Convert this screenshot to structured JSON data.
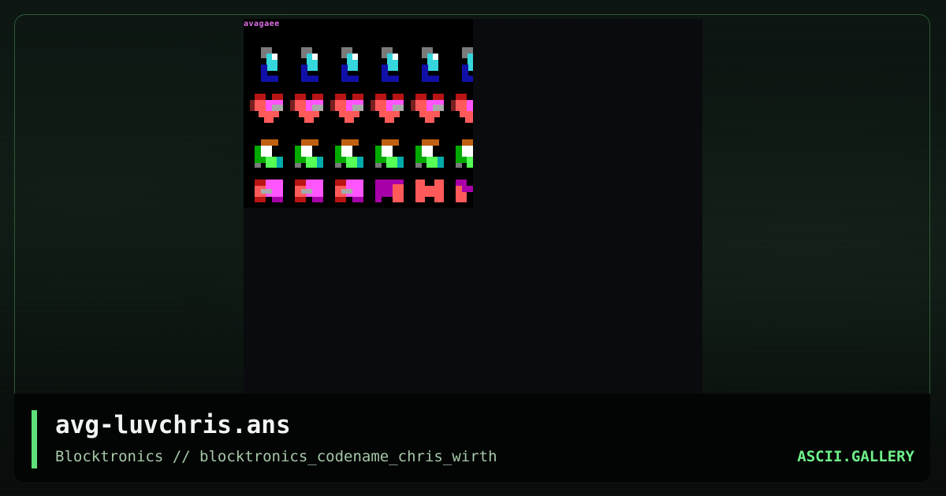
{
  "artwork": {
    "tag_text": "avagaee",
    "colors": {
      "grey": "#7a7a7a",
      "cyan": "#35d6dc",
      "navy": "#1010a8",
      "red_dark": "#b81414",
      "salmon": "#ff5a5a",
      "magenta": "#ff55ff",
      "purple": "#a800a8",
      "silver": "#aaaaaa",
      "orange": "#c06010",
      "white": "#ffffff",
      "green": "#55ff55",
      "green_dark": "#00aa00",
      "teal": "#00aaaa"
    },
    "rows": [
      "gem-row",
      "heart-row",
      "diamond-row",
      "bar-row"
    ]
  },
  "footer": {
    "title": "avg-luvchris.ans",
    "subtitle": "Blocktronics // blocktronics_codename_chris_wirth",
    "brand": "ASCII.GALLERY",
    "accent_color": "#5ee07a"
  }
}
